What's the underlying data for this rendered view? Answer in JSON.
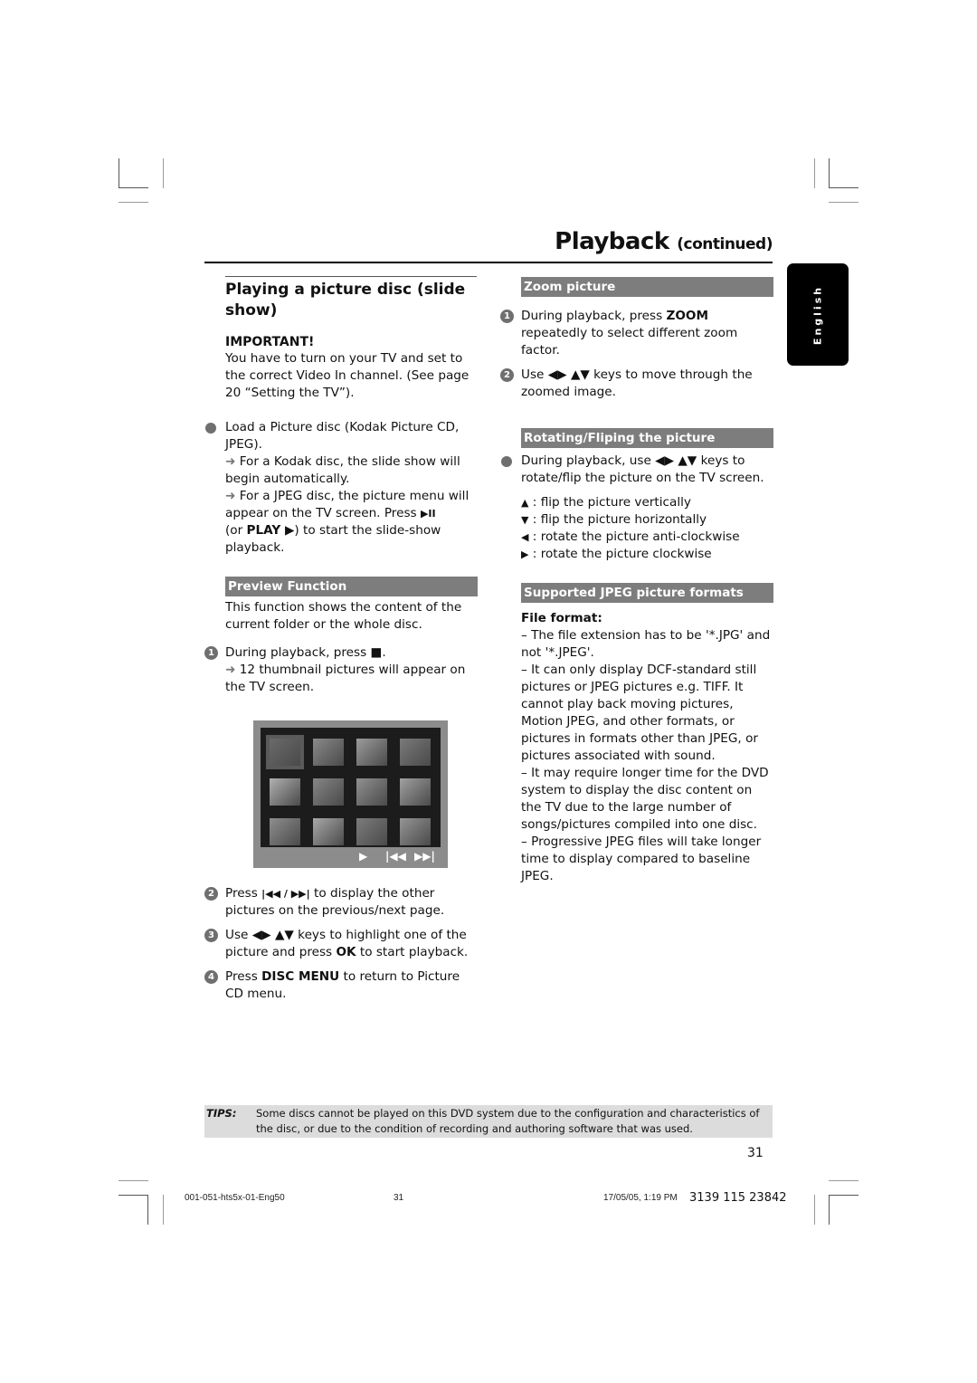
{
  "header": {
    "title": "Playback",
    "continued": "(continued)"
  },
  "language_tab": "English",
  "left": {
    "title": "Playing a picture disc (slide show)",
    "important_label": "IMPORTANT!",
    "important_text": "You have to turn on your TV and set to the correct Video In channel.  (See page 20 “Setting the TV”).",
    "load": {
      "text": "Load a Picture disc (Kodak Picture CD, JPEG).",
      "note1": "For a Kodak disc, the slide show will begin automatically.",
      "note2_a": "For a JPEG disc, the picture menu will appear on the TV screen.  Press ",
      "note2_key": "▶II",
      "note2_b": "(or ",
      "note2_play": "PLAY ▶",
      "note2_c": ") to start the slide-show playback."
    },
    "preview": {
      "heading": "Preview Function",
      "desc": "This function shows the content of the current folder or the whole disc.",
      "steps": [
        {
          "num": "1",
          "a": "During playback, press ",
          "key": "■",
          "b": ".",
          "note": "12 thumbnail pictures will appear on the TV screen."
        },
        {
          "num": "2",
          "a": "Press ",
          "key": "|◀◀ / ▶▶|",
          "b": " to display the other pictures on the previous/next page."
        },
        {
          "num": "3",
          "a": "Use ◀▶ ▲▼ keys to highlight one of the picture and press ",
          "key": "OK",
          "b": " to start playback."
        },
        {
          "num": "4",
          "a": "Press ",
          "key": "DISC MENU",
          "b": " to return to Picture CD menu."
        }
      ],
      "screen_controls": {
        "play": "▶",
        "prev": "|◀◀",
        "next": "▶▶|"
      },
      "thumbnail_count": 12
    }
  },
  "right": {
    "zoom": {
      "heading": "Zoom picture",
      "steps": [
        {
          "num": "1",
          "a": "During playback, press ",
          "key": "ZOOM",
          "b": " repeatedly to select different zoom factor."
        },
        {
          "num": "2",
          "a": "Use ◀▶ ▲▼ keys to move through the zoomed image."
        }
      ]
    },
    "rotate": {
      "heading": "Rotating/Fliping the picture",
      "text": "During playback, use ◀▶ ▲▼ keys to rotate/flip the picture on the TV screen.",
      "keys": [
        {
          "key": "▲",
          "desc": ": flip the picture vertically"
        },
        {
          "key": "▼",
          "desc": ": flip the picture horizontally"
        },
        {
          "key": "◀",
          "desc": ": rotate the picture anti-clockwise"
        },
        {
          "key": "▶",
          "desc": ": rotate the picture clockwise"
        }
      ]
    },
    "jpeg": {
      "heading": "Supported JPEG picture formats",
      "label": "File format:",
      "items": [
        "–  The file extension has to be '*.JPG' and not '*.JPEG'.",
        "–  It can only display DCF-standard still pictures or JPEG pictures e.g. TIFF.  It cannot play back moving pictures, Motion JPEG, and other formats, or pictures in formats other than JPEG, or pictures associated with sound.",
        "–  It may require longer time for the DVD system to display the disc content on the TV due to the large number of songs/pictures compiled into one disc.",
        "–  Progressive JPEG files will take longer time to display compared to baseline JPEG."
      ]
    }
  },
  "tips": {
    "label": "TIPS:",
    "text": "Some discs cannot be played on this DVD system due to the configuration and characteristics of the disc, or due to the condition of recording and authoring software that was used."
  },
  "page_number": "31",
  "footer": {
    "file": "001-051-hts5x-01-Eng50",
    "page": "31",
    "date": "17/05/05, 1:19 PM",
    "code": "3139 115 23842"
  }
}
